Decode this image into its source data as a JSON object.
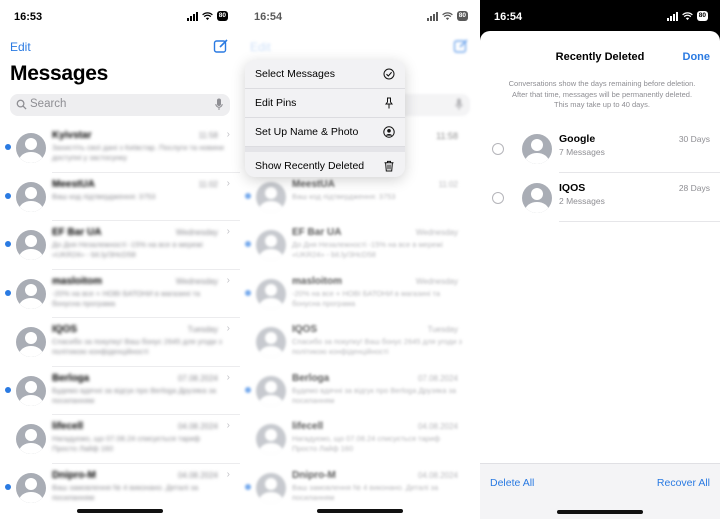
{
  "panel1": {
    "status_time": "16:53",
    "battery": "80",
    "edit_label": "Edit",
    "title": "Messages",
    "search_placeholder": "Search",
    "rows": [
      {
        "name": "Kyivstar",
        "date": "11:58",
        "preview": "Захистіть свої дані з Київстар. Послуги та новини доступні у застосунку",
        "unread": true
      },
      {
        "name": "MeestUA",
        "date": "11:02",
        "preview": "Ваш код підтвердження: 3753",
        "unread": true
      },
      {
        "name": "EF Bar UA",
        "date": "Wednesday",
        "preview": "До Дня Незалежності -15% на все в мережі «UKR24» - bit.ly/3HcD58",
        "unread": true
      },
      {
        "name": "masloitom",
        "date": "Wednesday",
        "preview": "-20% на все + НОВІ БАТОНИ в магазині та бонусна програма",
        "unread": true
      },
      {
        "name": "IQOS",
        "date": "Tuesday",
        "preview": "Спасибо за покупку! Ваш бонус 2645 для угоди з політикою конфіденційності",
        "unread": false
      },
      {
        "name": "Berloga",
        "date": "07.08.2024",
        "preview": "Будемо вдячні за відгук про Berloga Друзяка за посиланням",
        "unread": true
      },
      {
        "name": "lifecell",
        "date": "04.08.2024",
        "preview": "Нагадуємо, що 07.08.24 списується тариф Просто Лайф 160",
        "unread": false
      },
      {
        "name": "Dnipro-M",
        "date": "04.08.2024",
        "preview": "Ваш замовлення № 4 виконано. Деталі за посиланням",
        "unread": true
      }
    ]
  },
  "panel2": {
    "status_time": "16:54",
    "battery": "80",
    "edit_label": "Edit",
    "first_row_date": "11:58",
    "menu": [
      {
        "label": "Select Messages",
        "icon": "check-circle-icon"
      },
      {
        "label": "Edit Pins",
        "icon": "pin-icon"
      },
      {
        "label": "Set Up Name & Photo",
        "icon": "person-circle-icon"
      },
      {
        "label": "Show Recently Deleted",
        "icon": "trash-icon"
      }
    ]
  },
  "panel3": {
    "status_time": "16:54",
    "battery": "80",
    "title": "Recently Deleted",
    "done_label": "Done",
    "description": "Conversations show the days remaining before deletion. After that time, messages will be permanently deleted. This may take up to 40 days.",
    "items": [
      {
        "name": "Google",
        "count": "7 Messages",
        "days": "30 Days"
      },
      {
        "name": "IQOS",
        "count": "2 Messages",
        "days": "28 Days"
      }
    ],
    "delete_all_label": "Delete All",
    "recover_all_label": "Recover All"
  },
  "colors": {
    "accent": "#2a7ae2",
    "unread_dot": "#2a7ae2",
    "secondary_text": "#8e8e93"
  }
}
